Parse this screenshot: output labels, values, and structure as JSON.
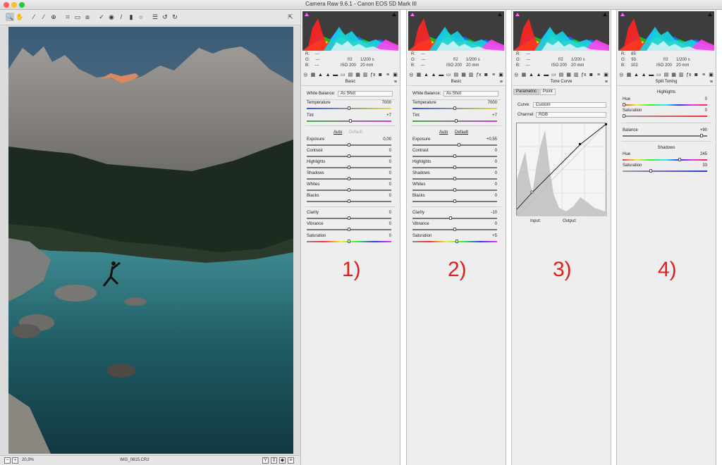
{
  "window": {
    "title": "Camera Raw 9.6.1  -  Canon EOS 5D Mark III"
  },
  "toolbar": {
    "tools": [
      "zoom-icon",
      "hand-icon",
      "white-balance-icon",
      "color-sampler-icon",
      "targeted-adjust-icon",
      "crop-icon",
      "straighten-icon",
      "transform-icon",
      "spot-removal-icon",
      "red-eye-icon",
      "adjustment-brush-icon",
      "graduated-filter-icon",
      "radial-filter-icon",
      "preferences-icon",
      "rotate-left-icon",
      "rotate-right-icon"
    ]
  },
  "status": {
    "zoom": "20,9%",
    "filename": "IMG_0815.CR2"
  },
  "panels": [
    {
      "id": "1",
      "rgb": {
        "r": "---",
        "g": "---",
        "b": "---"
      },
      "exif": {
        "aperture": "f/2",
        "shutter": "1/200 s",
        "iso": "ISO 200",
        "focal": "20 mm"
      },
      "title": "Basic",
      "wb_label": "White Balance:",
      "wb_value": "As Shot",
      "auto": "Auto",
      "default": "Default",
      "sliders": [
        {
          "label": "Temperature",
          "value": "7000",
          "pos": 0.5
        },
        {
          "label": "Tint",
          "value": "+7",
          "pos": 0.52
        },
        {
          "label": "Exposure",
          "value": "0,00",
          "pos": 0.5
        },
        {
          "label": "Contrast",
          "value": "0",
          "pos": 0.5
        },
        {
          "label": "Highlights",
          "value": "0",
          "pos": 0.5
        },
        {
          "label": "Shadows",
          "value": "0",
          "pos": 0.5
        },
        {
          "label": "Whites",
          "value": "0",
          "pos": 0.5
        },
        {
          "label": "Blacks",
          "value": "0",
          "pos": 0.5
        },
        {
          "label": "Clarity",
          "value": "0",
          "pos": 0.5
        },
        {
          "label": "Vibrance",
          "value": "0",
          "pos": 0.5
        },
        {
          "label": "Saturation",
          "value": "0",
          "pos": 0.5
        }
      ],
      "number": "1)"
    },
    {
      "id": "2",
      "rgb": {
        "r": "---",
        "g": "---",
        "b": "---"
      },
      "exif": {
        "aperture": "f/2",
        "shutter": "1/200 s",
        "iso": "ISO 200",
        "focal": "20 mm"
      },
      "title": "Basic",
      "wb_label": "White Balance:",
      "wb_value": "As Shot",
      "auto": "Auto",
      "default": "Default",
      "sliders": [
        {
          "label": "Temperature",
          "value": "7000",
          "pos": 0.5
        },
        {
          "label": "Tint",
          "value": "+7",
          "pos": 0.52
        },
        {
          "label": "Exposure",
          "value": "+0,55",
          "pos": 0.55
        },
        {
          "label": "Contrast",
          "value": "0",
          "pos": 0.5
        },
        {
          "label": "Highlights",
          "value": "0",
          "pos": 0.5
        },
        {
          "label": "Shadows",
          "value": "0",
          "pos": 0.5
        },
        {
          "label": "Whites",
          "value": "0",
          "pos": 0.5
        },
        {
          "label": "Blacks",
          "value": "0",
          "pos": 0.5
        },
        {
          "label": "Clarity",
          "value": "-10",
          "pos": 0.45
        },
        {
          "label": "Vibrance",
          "value": "0",
          "pos": 0.5
        },
        {
          "label": "Saturation",
          "value": "+5",
          "pos": 0.53
        }
      ],
      "number": "2)"
    },
    {
      "id": "3",
      "rgb": {
        "r": "---",
        "g": "---",
        "b": "---"
      },
      "exif": {
        "aperture": "f/2",
        "shutter": "1/200 s",
        "iso": "ISO 200",
        "focal": "20 mm"
      },
      "title": "Tone Curve",
      "tabs": [
        "Parametric",
        "Point"
      ],
      "curve_label": "Curve:",
      "curve_value": "Custom",
      "channel_label": "Channel:",
      "channel_value": "RGB",
      "input_label": "Input:",
      "output_label": "Output:",
      "number": "3)"
    },
    {
      "id": "4",
      "rgb": {
        "r": "85",
        "g": "93",
        "b": "102"
      },
      "exif": {
        "aperture": "f/2",
        "shutter": "1/200 s",
        "iso": "ISO 200",
        "focal": "20 mm"
      },
      "title": "Split Toning",
      "highlights": "Highlights",
      "hl_hue": {
        "label": "Hue",
        "value": "0",
        "pos": 0.0
      },
      "hl_sat": {
        "label": "Saturation",
        "value": "0",
        "pos": 0.0
      },
      "balance": {
        "label": "Balance",
        "value": "+90",
        "pos": 0.95
      },
      "shadows": "Shadows",
      "sh_hue": {
        "label": "Hue",
        "value": "245",
        "pos": 0.68
      },
      "sh_sat": {
        "label": "Saturation",
        "value": "33",
        "pos": 0.33
      },
      "number": "4)"
    }
  ],
  "colors": {
    "accent_number": "#e02020",
    "panel_bg": "#eeeeee"
  }
}
